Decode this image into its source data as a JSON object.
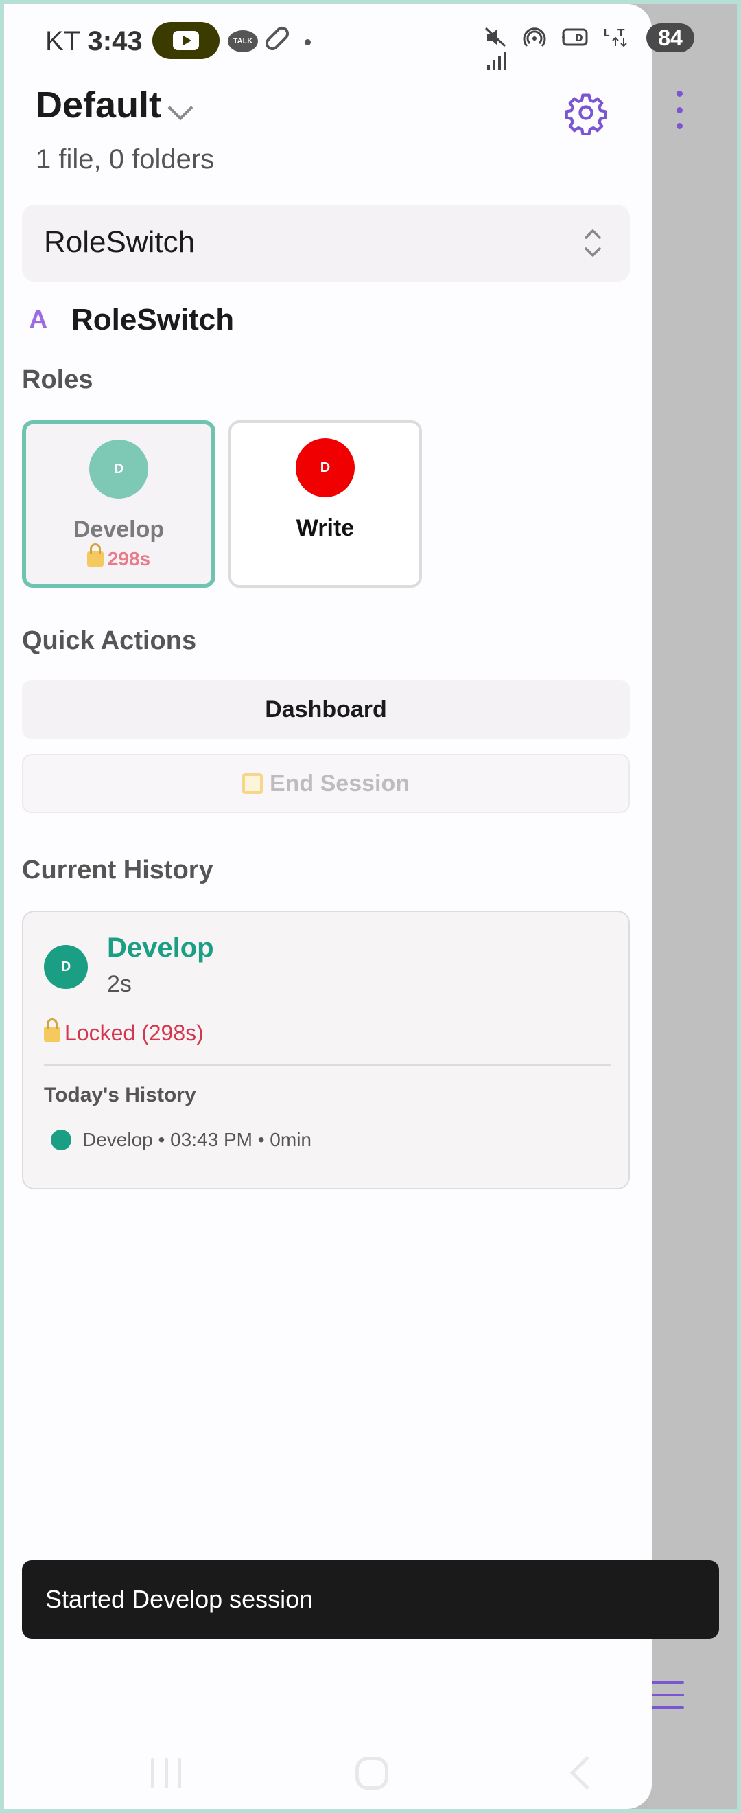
{
  "status_bar": {
    "carrier": "KT",
    "time": "3:43",
    "talk_label": "TALK",
    "battery": "84",
    "icons": [
      "mute-icon",
      "hotspot-icon",
      "hd-icon",
      "lte-icon",
      "signal-icon"
    ]
  },
  "header": {
    "title": "Default",
    "subtitle": "1 file, 0 folders"
  },
  "selector": {
    "value": "RoleSwitch"
  },
  "app": {
    "glyph": "A",
    "name": "RoleSwitch"
  },
  "roles_section": {
    "title": "Roles",
    "cards": [
      {
        "initial": "D",
        "name": "Develop",
        "lock": "298s",
        "color": "#7ec9b6",
        "active": true
      },
      {
        "initial": "D",
        "name": "Write",
        "color": "#f00000",
        "active": false
      }
    ]
  },
  "quick_actions": {
    "title": "Quick Actions",
    "dashboard_label": "Dashboard",
    "end_session_label": "End Session"
  },
  "history": {
    "title": "Current History",
    "initial": "D",
    "role": "Develop",
    "duration": "2s",
    "lock_status": "Locked (298s)",
    "today_title": "Today's History",
    "entries": [
      "Develop • 03:43 PM • 0min"
    ]
  },
  "toast": {
    "message": "Started Develop session"
  },
  "colors": {
    "accent": "#7a56d2",
    "teal": "#1a9e84",
    "active_border": "#6ec4b1",
    "lock_red": "#d43650"
  }
}
